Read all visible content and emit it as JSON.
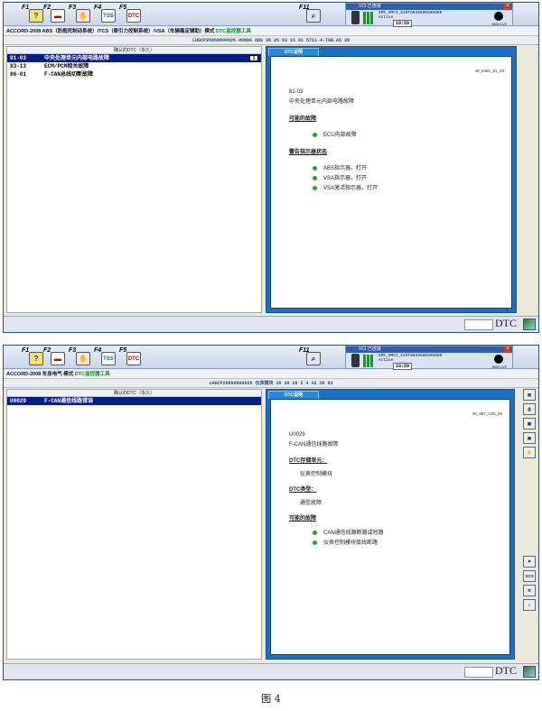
{
  "toolbar": {
    "f1": "F1",
    "f2": "F2",
    "f3": "F3",
    "f4": "F4",
    "f5": "F5",
    "f11": "F11",
    "tss_text": "TSS",
    "dtc_text": "DTC",
    "help_text": "?"
  },
  "vci": {
    "title": "VCI 已连接",
    "line1": "SPE_HMCI_S1RT6N40580505060",
    "line2": "Active",
    "time": "19:59",
    "logo": "HMCI-V2"
  },
  "screen1": {
    "breadcrumb": "ACCORD-2008 ABS（防抱死制动系统）/TCS（牵引力控制系统）/VSA（车辆稳定辅助）模式",
    "breadcrumb_mode": "DTC监控器工具",
    "vin_bar": "LHGCP26868800026 HONDA ABS 38 26 03 15 01 5711-4-TAB-A5 38",
    "list_header": "确认的DTC（永久）",
    "dtc_rows": [
      {
        "code": "81-03",
        "desc": "中央处理单元内部电路故障",
        "flag": "1"
      },
      {
        "code": "83-13",
        "desc": "ECM/PCM相关故障"
      },
      {
        "code": "86-01",
        "desc": "F-CAN总线切断故障"
      }
    ],
    "tab": "DTC说明",
    "doc_id": "48_6481_81_03",
    "detail_code": "81-03",
    "detail_name": "中央处理单元内部电路故障",
    "section_causes": "可能的故障",
    "causes": [
      "ECU内部故障"
    ],
    "section_indicators": "警告指示器状态",
    "indicators": [
      "ABS指示器，打开",
      "VSA指示器，打开",
      "VSA激活指示器，打开"
    ],
    "status_badge": "DTC"
  },
  "screen2": {
    "breadcrumb": "ACCORD-2008 车身电气 模式",
    "breadcrumb_mode": "DTC监控器工具",
    "vin_bar": "LHGCP26868800026 仪表模块 38 38 26 5 4 42 38 83",
    "list_header": "确认的DTC（永久）",
    "dtc_rows": [
      {
        "code": "U0029",
        "desc": "F-CAN通信线路错误"
      }
    ],
    "tab": "DTC说明",
    "doc_id": "48_887_U00_29",
    "detail_code": "U0029",
    "detail_name": "F-CAN通信线路故障",
    "section_storage": "DTC存储单元：",
    "storage_value": "仪表控制模块",
    "section_type": "DTC类型：",
    "type_value": "通信故障",
    "section_causes": "可能的故障",
    "causes": [
      "CAN通信线路断路或短路",
      "仪表控制模块接线断路"
    ],
    "status_badge": "DTC",
    "sidebar_icons": [
      "folder-icon",
      "print-icon",
      "save-icon",
      "picture-icon",
      "hand-icon",
      "flag-icon",
      "scs-icon",
      "tool-icon",
      "doc-icon"
    ],
    "sidebar_scs": "SCS"
  },
  "caption": "图 4"
}
